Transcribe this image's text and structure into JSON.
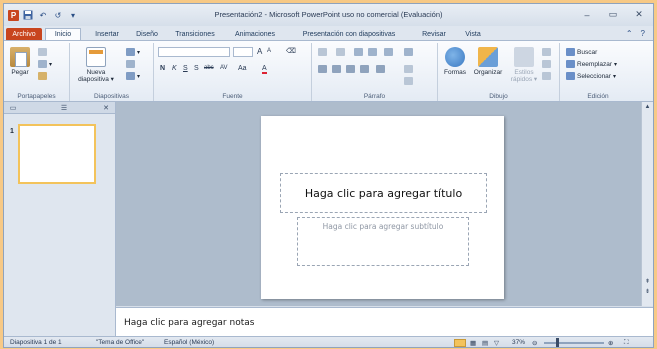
{
  "window": {
    "title": "Presentación2  -  Microsoft PowerPoint uso no comercial (Evaluación)",
    "app_icon": "P"
  },
  "qat": {
    "save_icon": "save-icon",
    "undo": "↶",
    "redo": "↺",
    "customize": "▾"
  },
  "controls": {
    "minimize": "–",
    "maximize": "▭",
    "close": "✕"
  },
  "tabs": [
    "Archivo",
    "Inicio",
    "Insertar",
    "Diseño",
    "Transiciones",
    "Animaciones",
    "Presentación con diapositivas",
    "Revisar",
    "Vista"
  ],
  "ribbon": {
    "portapapeles": {
      "paste": "Pegar",
      "label": "Portapapeles"
    },
    "diapositivas": {
      "new_slide": "Nueva\ndiapositiva",
      "new_slide_line1": "Nueva",
      "new_slide_line2": "diapositiva ▾",
      "label": "Diapositivas"
    },
    "fuente": {
      "grow": "A",
      "shrink": "A",
      "bold": "N",
      "italic": "K",
      "underline": "S",
      "strike": "S",
      "strike_text": "abc",
      "spacing": "AV",
      "case": "Aa",
      "color": "A",
      "label": "Fuente"
    },
    "parrafo": {
      "label": "Párrafo"
    },
    "dibujo": {
      "shapes": "Formas",
      "arrange": "Organizar",
      "quick_styles": "Estilos\nrápidos",
      "quick_styles_line1": "Estilos",
      "quick_styles_line2": "rápidos ▾",
      "label": "Dibujo"
    },
    "edicion": {
      "find": "Buscar",
      "replace": "Reemplazar",
      "select": "Seleccionar",
      "label": "Edición"
    }
  },
  "slide_pane": {
    "thumb_number": "1"
  },
  "slide": {
    "title_placeholder": "Haga clic para agregar título",
    "subtitle_placeholder": "Haga clic para agregar subtítulo"
  },
  "notes": {
    "placeholder": "Haga clic para agregar notas"
  },
  "status": {
    "slide": "Diapositiva 1 de 1",
    "theme": "\"Tema de Office\"",
    "language": "Español (México)",
    "zoom": "37%"
  },
  "colors": {
    "accent": "#c8451e",
    "thumb_border": "#f3c35b"
  }
}
